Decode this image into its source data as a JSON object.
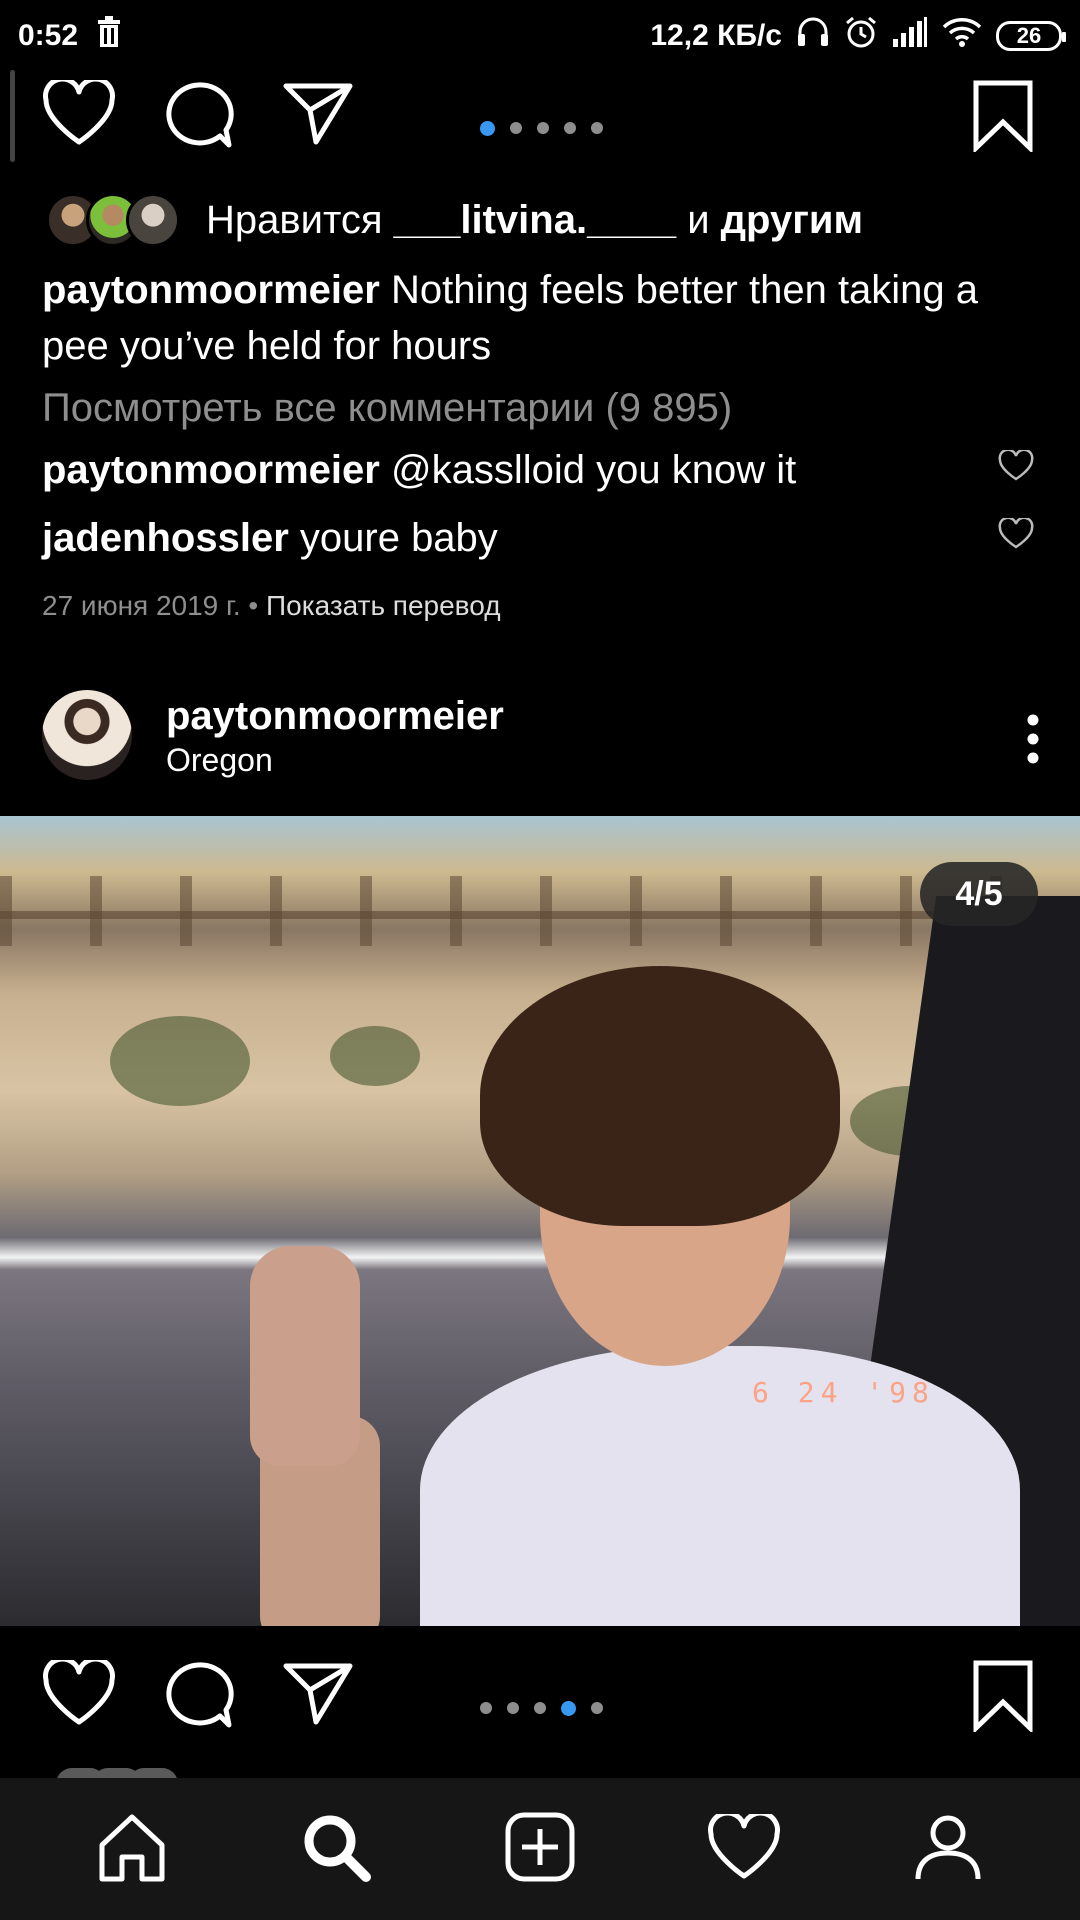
{
  "status_bar": {
    "time": "0:52",
    "network_speed": "12,2 КБ/с",
    "battery": "26"
  },
  "post_top": {
    "carousel_active_index": 0,
    "carousel_total": 5,
    "likes": {
      "prefix": "Нравится",
      "user": "___litvina.____",
      "connector": "и",
      "others": "другим"
    },
    "caption": {
      "user": "paytonmoormeier",
      "text": "Nothing feels better then taking a pee you’ve held for hours"
    },
    "view_comments": "Посмотреть все комментарии (9 895)",
    "comments": [
      {
        "user": "paytonmoormeier",
        "text": "@kasslloid you know it"
      },
      {
        "user": "jadenhossler",
        "text": "youre baby"
      }
    ],
    "date": "27 июня 2019 г.",
    "separator": "•",
    "translate": "Показать перевод"
  },
  "post_bottom": {
    "username": "paytonmoormeier",
    "location": "Oregon",
    "photo_counter": "4/5",
    "photo_stamp": "6 24 '98",
    "carousel_active_index": 3,
    "carousel_total": 5
  },
  "icons": {
    "like": "heart-icon",
    "comment": "comment-icon",
    "share": "send-icon",
    "save": "bookmark-icon",
    "more": "more-vertical-icon",
    "nav": [
      "home-icon",
      "search-icon",
      "add-icon",
      "activity-heart-icon",
      "profile-icon"
    ]
  },
  "colors": {
    "background": "#000000",
    "active_dot": "#3897f0",
    "secondary_text": "#8e8e8e",
    "nav_background": "#161616"
  }
}
